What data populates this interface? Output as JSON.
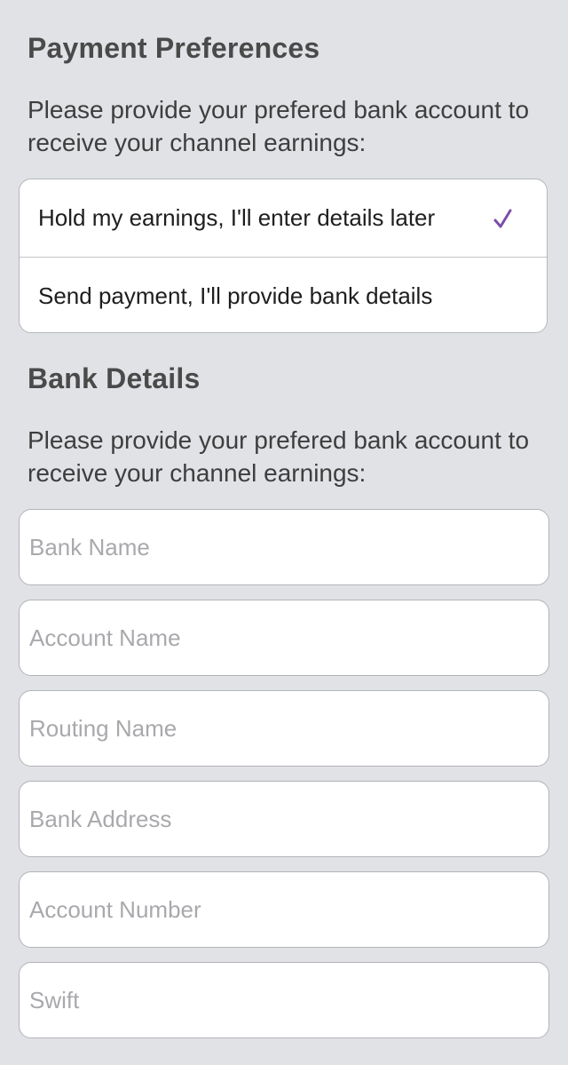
{
  "payment": {
    "title": "Payment Preferences",
    "description": "Please provide your prefered bank account to receive your channel earnings:",
    "options": [
      {
        "label": "Hold my earnings, I'll enter details later",
        "selected": true
      },
      {
        "label": "Send payment, I'll provide bank details",
        "selected": false
      }
    ],
    "check_icon": "checkmark-icon",
    "accent_color": "#7b4fa8"
  },
  "bank": {
    "title": "Bank Details",
    "description": "Please provide your prefered bank account to receive your channel earnings:",
    "fields": [
      {
        "placeholder": "Bank Name",
        "value": ""
      },
      {
        "placeholder": "Account Name",
        "value": ""
      },
      {
        "placeholder": "Routing Name",
        "value": ""
      },
      {
        "placeholder": "Bank Address",
        "value": ""
      },
      {
        "placeholder": "Account Number",
        "value": ""
      },
      {
        "placeholder": "Swift",
        "value": ""
      }
    ]
  }
}
